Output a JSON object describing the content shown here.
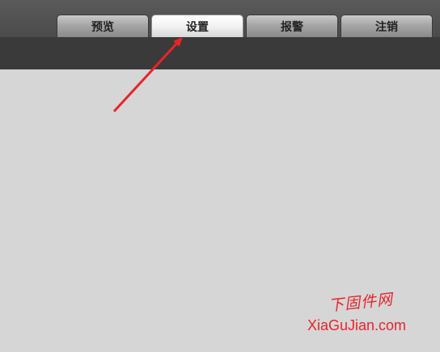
{
  "tabs": [
    {
      "label": "预览",
      "active": false
    },
    {
      "label": "设置",
      "active": true
    },
    {
      "label": "报警",
      "active": false
    },
    {
      "label": "注销",
      "active": false
    }
  ],
  "watermark": {
    "cn": "下固件网",
    "en": "XiaGuJian.com",
    "color": "#e8242a"
  },
  "annotation": {
    "arrow_color": "#e8242a"
  }
}
